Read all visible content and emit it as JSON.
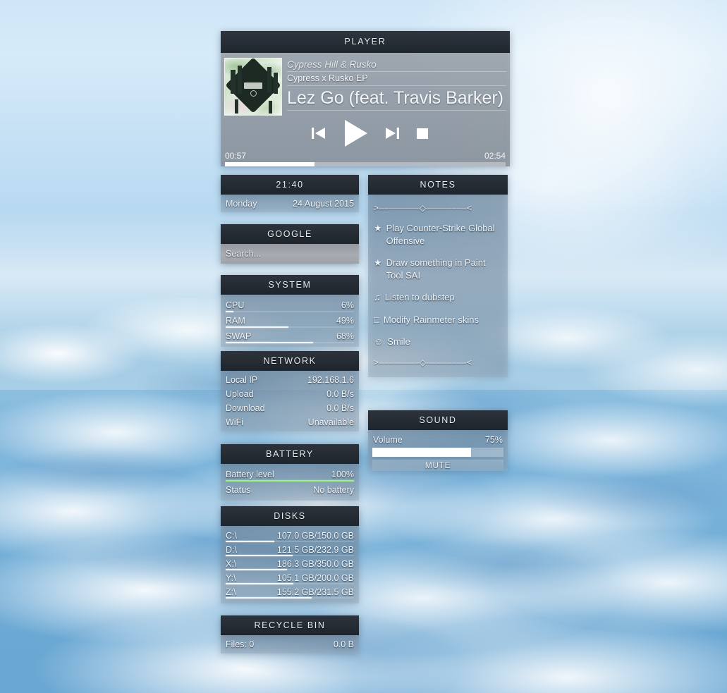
{
  "player": {
    "title": "PLAYER",
    "artist": "Cypress Hill & Rusko",
    "album": "Cypress x Rusko EP",
    "track": "Lez Go (feat. Travis Barker)",
    "time_elapsed": "00:57",
    "time_total": "02:54",
    "progress_percent": 32,
    "controls": {
      "previous": "previous-track",
      "play": "play",
      "next": "next-track",
      "stop": "stop"
    }
  },
  "clock": {
    "title": "21:40",
    "day": "Monday",
    "date": "24 August 2015"
  },
  "google": {
    "title": "GOOGLE",
    "search_placeholder": "Search...",
    "search_value": ""
  },
  "system": {
    "title": "SYSTEM",
    "rows": [
      {
        "label": "CPU",
        "value": "6%",
        "percent": 6
      },
      {
        "label": "RAM",
        "value": "49%",
        "percent": 49
      },
      {
        "label": "SWAP",
        "value": "68%",
        "percent": 68
      }
    ]
  },
  "network": {
    "title": "NETWORK",
    "rows": [
      {
        "label": "Local IP",
        "value": "192.168.1.6"
      },
      {
        "label": "Upload",
        "value": "0.0 B/s"
      },
      {
        "label": "Download",
        "value": "0.0 B/s"
      },
      {
        "label": "WiFi",
        "value": "Unavailable"
      }
    ]
  },
  "battery": {
    "title": "BATTERY",
    "level_label": "Battery level",
    "level_value": "100%",
    "level_percent": 100,
    "status_label": "Status",
    "status_value": "No battery",
    "bar_color": "#9bf08a"
  },
  "disks": {
    "title": "DISKS",
    "rows": [
      {
        "label": "C:\\",
        "value": "107.0 GB/150.0 GB",
        "percent": 38
      },
      {
        "label": "D:\\",
        "value": "121.5 GB/232.9 GB",
        "percent": 52
      },
      {
        "label": "X:\\",
        "value": "186.3 GB/350.0 GB",
        "percent": 48
      },
      {
        "label": "Y:\\",
        "value": "105.1 GB/200.0 GB",
        "percent": 53
      },
      {
        "label": "Z:\\",
        "value": "155.2 GB/231.5 GB",
        "percent": 67
      }
    ]
  },
  "recycle": {
    "title": "RECYCLE BIN",
    "files_label": "Files: 0",
    "size_value": "0.0 B"
  },
  "notes": {
    "title": "NOTES",
    "divider_top": ">––––––––◇––––––––<",
    "divider_bottom": ">––––––––◇––––––––<",
    "items": [
      {
        "bullet": "★",
        "bullet_name": "star-icon",
        "text": "Play Counter-Strike Global Offensive"
      },
      {
        "bullet": "★",
        "bullet_name": "star-icon",
        "text": "Draw something in Paint Tool SAI"
      },
      {
        "bullet": "♫",
        "bullet_name": "music-note-icon",
        "text": "Listen to dubstep"
      },
      {
        "bullet": "□",
        "bullet_name": "checkbox-icon",
        "text": "Modify Rainmeter skins"
      },
      {
        "bullet": "☺",
        "bullet_name": "smiley-icon",
        "text": "Smile"
      }
    ]
  },
  "sound": {
    "title": "SOUND",
    "volume_label": "Volume",
    "volume_value": "75%",
    "volume_percent": 75,
    "mute_label": "MUTE"
  },
  "theme": {
    "header_bg": "#262c34",
    "body_text": "#f2f5f8",
    "accent_bar": "#f4f8fb",
    "battery_bar": "#9bf08a"
  }
}
